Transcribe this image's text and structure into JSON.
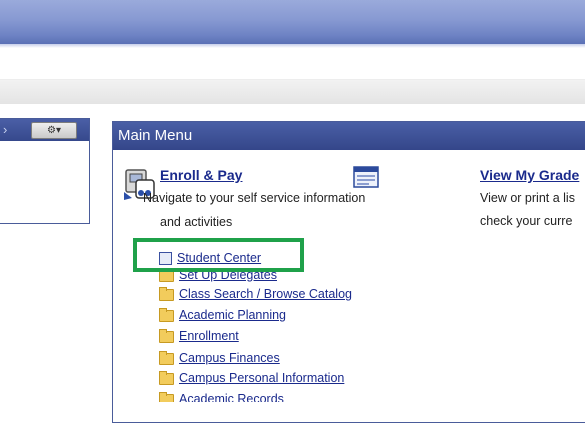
{
  "left_panel": {
    "gear_label": "⚙▾"
  },
  "main_menu": {
    "title": "Main Menu",
    "enroll_pay": {
      "title": "Enroll & Pay",
      "description_line1": "Navigate to your self service information",
      "description_line2": "and activities",
      "items": [
        {
          "label": "Student Center",
          "icon": "page-icon"
        },
        {
          "label": "Set Up Delegates",
          "icon": "folder-icon"
        },
        {
          "label": "Class Search / Browse Catalog",
          "icon": "folder-icon"
        },
        {
          "label": "Academic Planning",
          "icon": "folder-icon"
        },
        {
          "label": "Enrollment",
          "icon": "folder-icon"
        },
        {
          "label": "Campus Finances",
          "icon": "folder-icon"
        },
        {
          "label": "Campus Personal Information",
          "icon": "folder-icon"
        },
        {
          "label": "Academic Records",
          "icon": "folder-icon"
        }
      ]
    },
    "view_grades": {
      "title": "View My Grade",
      "description_line1": "View or print a lis",
      "description_line2": "check your curre"
    }
  },
  "colors": {
    "header_blue": "#3f53a0",
    "link_blue": "#1a2a8c",
    "highlight_green": "#1fa14a"
  }
}
